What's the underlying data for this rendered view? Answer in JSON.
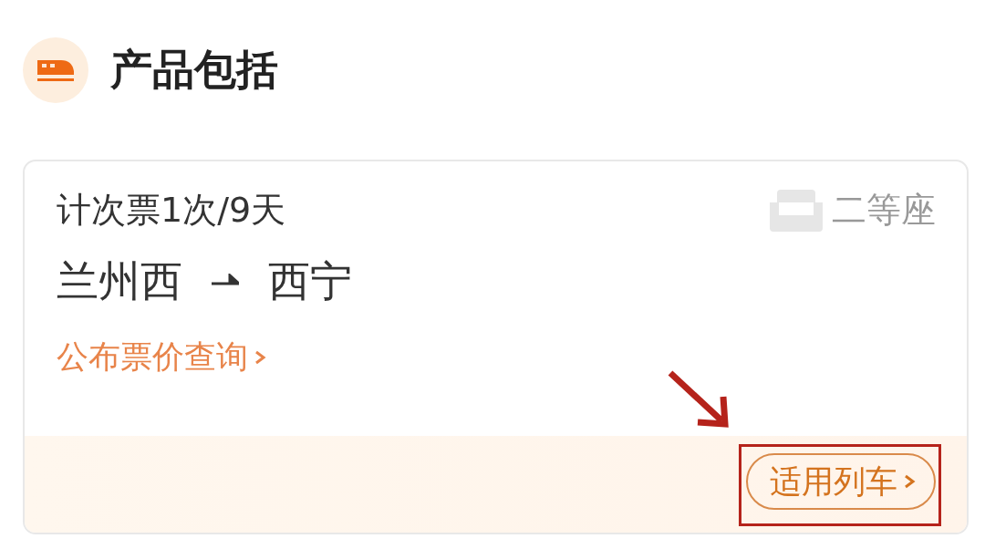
{
  "section": {
    "title": "产品包括"
  },
  "ticket": {
    "type": "计次票1次/9天",
    "seat_class": "二等座",
    "from": "兰州西",
    "to": "西宁",
    "fare_link": "公布票价查询",
    "trains_button": "适用列车"
  },
  "annotation": {
    "highlight": true
  }
}
